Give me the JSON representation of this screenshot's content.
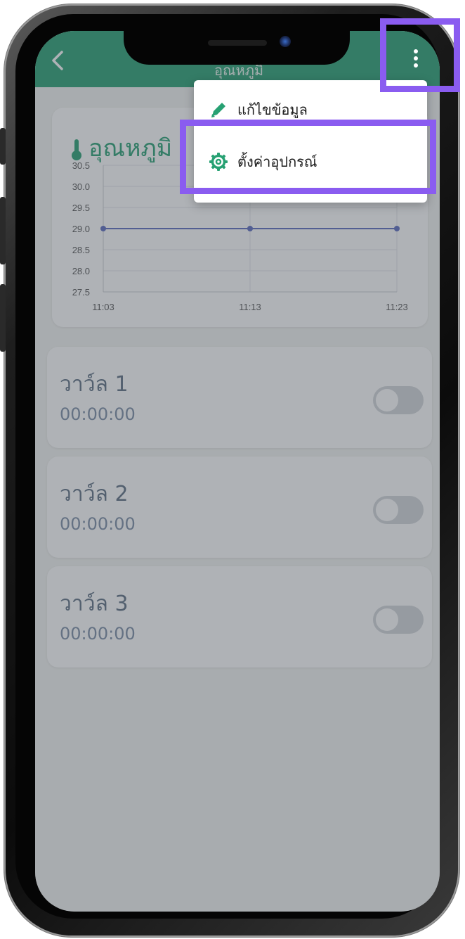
{
  "app_bar": {
    "title": "อุณหภูมิ",
    "accent_color": "#27a173",
    "back_icon": "chevron-left-icon",
    "more_icon": "more-vertical-icon"
  },
  "menu": {
    "items": [
      {
        "label": "แก้ไขข้อมูล",
        "icon": "pencil-icon"
      },
      {
        "label": "ตั้งค่าอุปกรณ์",
        "icon": "gear-icon"
      }
    ]
  },
  "temperature_card": {
    "title": "อุณหภูมิ",
    "icon": "thermometer-icon"
  },
  "chart_data": {
    "type": "line",
    "x": [
      "11:03",
      "11:13",
      "11:23"
    ],
    "series": [
      {
        "values": [
          29.0,
          29.0,
          29.0
        ]
      }
    ],
    "ylim": [
      27.5,
      30.5
    ],
    "yticks": [
      "30.5",
      "30.0",
      "29.5",
      "29.0",
      "28.5",
      "28.0",
      "27.5"
    ],
    "grid": true,
    "line_color": "#5c6bc0"
  },
  "valves": [
    {
      "name": "วาว์ล 1",
      "time": "00:00:00",
      "on": false
    },
    {
      "name": "วาว์ล 2",
      "time": "00:00:00",
      "on": false
    },
    {
      "name": "วาว์ล 3",
      "time": "00:00:00",
      "on": false
    }
  ],
  "highlight_color": "#8a5cf0"
}
